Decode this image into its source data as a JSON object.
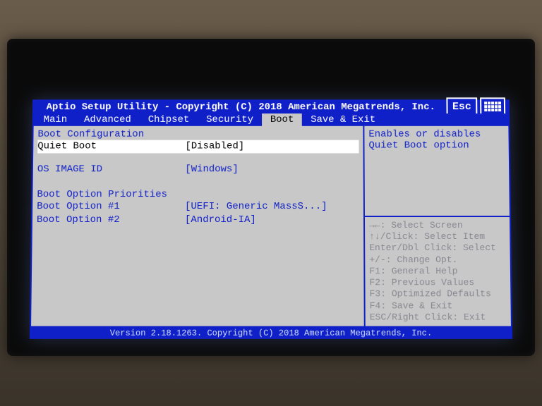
{
  "title": "Aptio Setup Utility - Copyright (C) 2018 American Megatrends, Inc.",
  "icons": {
    "esc": "Esc"
  },
  "tabs": [
    "Main",
    "Advanced",
    "Chipset",
    "Security",
    "Boot",
    "Save & Exit"
  ],
  "active_tab": "Boot",
  "sections": {
    "config_header": "Boot Configuration",
    "quiet_boot": {
      "label": "Quiet Boot",
      "value": "[Disabled]"
    },
    "os_image": {
      "label": "OS IMAGE ID",
      "value": "[Windows]"
    },
    "priorities_header": "Boot Option Priorities",
    "opt1": {
      "label": "Boot Option #1",
      "value": "[UEFI: Generic MassS...]"
    },
    "opt2": {
      "label": "Boot Option #2",
      "value": "[Android-IA]"
    }
  },
  "help": {
    "line1": "Enables or disables",
    "line2": "Quiet Boot option"
  },
  "keyhelp": [
    "→←: Select Screen",
    "↑↓/Click: Select Item",
    "Enter/Dbl Click: Select",
    "+/-: Change Opt.",
    "F1: General Help",
    "F2: Previous Values",
    "F3: Optimized Defaults",
    "F4: Save & Exit",
    "ESC/Right Click: Exit"
  ],
  "footer": "Version 2.18.1263. Copyright (C) 2018 American Megatrends, Inc."
}
